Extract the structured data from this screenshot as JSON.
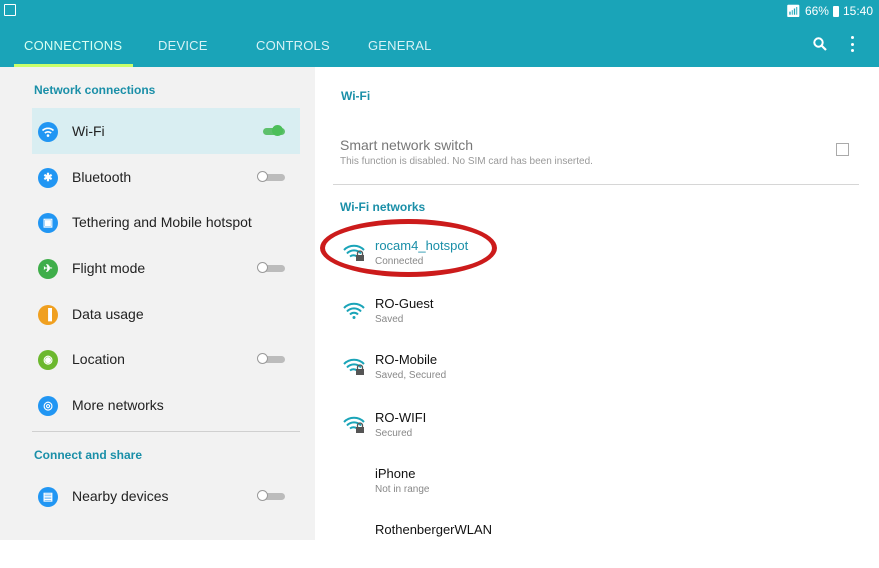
{
  "status_bar": {
    "battery": "66%",
    "time": "15:40"
  },
  "tabs": [
    {
      "label": "CONNECTIONS",
      "active": true
    },
    {
      "label": "DEVICE",
      "active": false
    },
    {
      "label": "CONTROLS",
      "active": false
    },
    {
      "label": "GENERAL",
      "active": false
    }
  ],
  "left": {
    "section1": "Network connections",
    "items": [
      {
        "label": "Wi-Fi",
        "icon": "wifi-icon",
        "toggle": "on"
      },
      {
        "label": "Bluetooth",
        "icon": "bluetooth-icon",
        "toggle": "off"
      },
      {
        "label": "Tethering and Mobile hotspot",
        "icon": "hotspot-icon"
      },
      {
        "label": "Flight mode",
        "icon": "flight-icon",
        "toggle": "off"
      },
      {
        "label": "Data usage",
        "icon": "data-usage-icon"
      },
      {
        "label": "Location",
        "icon": "location-icon",
        "toggle": "off"
      },
      {
        "label": "More networks",
        "icon": "more-networks-icon"
      }
    ],
    "section2": "Connect and share",
    "items2": [
      {
        "label": "Nearby devices",
        "icon": "nearby-devices-icon",
        "toggle": "off"
      }
    ]
  },
  "right": {
    "wifi_heading": "Wi-Fi",
    "smart_switch_title": "Smart network switch",
    "smart_switch_desc": "This function is disabled. No SIM card has been inserted.",
    "networks_heading": "Wi-Fi networks",
    "networks": [
      {
        "name": "rocam4_hotspot",
        "status": "Connected",
        "secured": true,
        "icon": "wifi-secured-icon"
      },
      {
        "name": "RO-Guest",
        "status": "Saved",
        "secured": false,
        "icon": "wifi-icon"
      },
      {
        "name": "RO-Mobile",
        "status": "Saved, Secured",
        "secured": true,
        "icon": "wifi-secured-icon"
      },
      {
        "name": "RO-WIFI",
        "status": "Secured",
        "secured": true,
        "icon": "wifi-secured-icon"
      },
      {
        "name": "iPhone",
        "status": "Not in range",
        "secured": false,
        "icon": ""
      },
      {
        "name": "RothenbergerWLAN",
        "status": "",
        "secured": false,
        "icon": ""
      }
    ]
  },
  "colors": {
    "accent": "#1aa4b8",
    "highlight": "#cc1b1b",
    "toggle_on": "#4dbf5a"
  }
}
